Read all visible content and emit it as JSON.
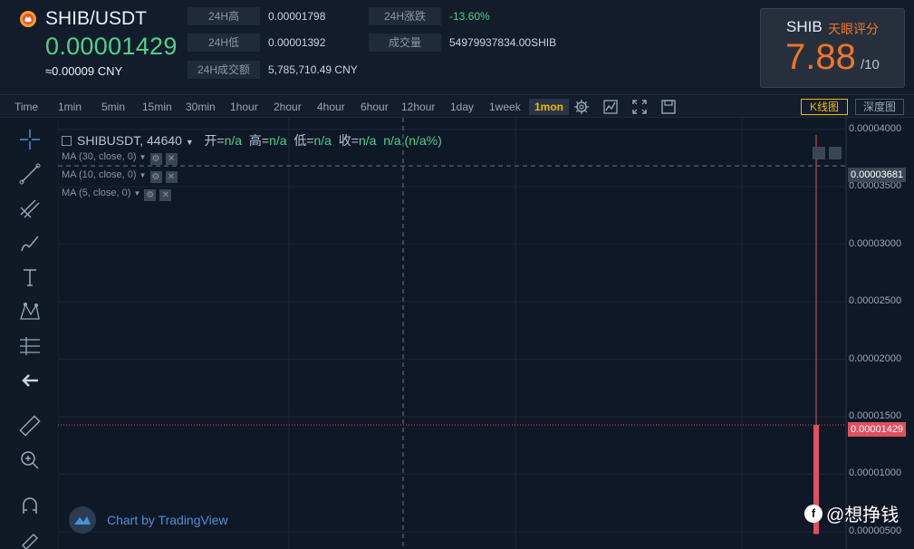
{
  "header": {
    "pair": "SHIB/USDT",
    "price": "0.00001429",
    "price_cny": "≈0.00009 CNY",
    "stats": [
      {
        "label": "24H高",
        "value": "0.00001798"
      },
      {
        "label": "24H低",
        "value": "0.00001392"
      },
      {
        "label": "24H成交额",
        "value": "5,785,710.49 CNY"
      },
      {
        "label": "24H涨跌",
        "value": "-13.60%"
      },
      {
        "label": "成交量",
        "value": "54979937834.00SHIB"
      }
    ],
    "change_color": "#4fd18b"
  },
  "rating": {
    "coin": "SHIB",
    "title": "天眼评分",
    "score": "7.88",
    "max": "/10"
  },
  "toolbar": {
    "timeframes": [
      "Time",
      "1min",
      "5min",
      "15min",
      "30min",
      "1hour",
      "2hour",
      "4hour",
      "6hour",
      "12hour",
      "1day",
      "1week",
      "1mon"
    ],
    "active": "1mon",
    "views": [
      "K线图",
      "深度图"
    ],
    "active_view": "K线图"
  },
  "left_tools": [
    "crosshair-icon",
    "trend-line-icon",
    "pitchfork-icon",
    "brush-icon",
    "text-icon",
    "pattern-icon",
    "measure-icon",
    "back-arrow-icon",
    "ruler-icon",
    "zoom-icon",
    "magnet-icon",
    "lock-icon"
  ],
  "legend": {
    "symbol": "SHIBUSDT, 44640",
    "open_label": "开=",
    "open": "n/a",
    "high_label": "高=",
    "high": "n/a",
    "low_label": "低=",
    "low": "n/a",
    "close_label": "收=",
    "close": "n/a",
    "change": "n/a (n/a%)",
    "ma": [
      "MA (30, close, 0)",
      "MA (10, close, 0)",
      "MA (5, close, 0)"
    ]
  },
  "chart_data": {
    "type": "bar",
    "y_ticks": [
      "0.00004000",
      "0.00003500",
      "0.00003000",
      "0.00002500",
      "0.00002000",
      "0.00001500",
      "0.00001000",
      "0.00000500"
    ],
    "ylim": [
      3.5e-06,
      4.1e-05
    ],
    "crosshair_value": "0.00003681",
    "last_price": "0.00001429",
    "candle": {
      "open": 3.68e-05,
      "high": 3.95e-05,
      "low": 4.8e-06,
      "close": 1.429e-05
    },
    "colors": {
      "down": "#e0505f",
      "grid": "#1b2636",
      "price_line": "#e0505f"
    }
  },
  "watermark": "Chart by TradingView",
  "social": "@想挣钱"
}
